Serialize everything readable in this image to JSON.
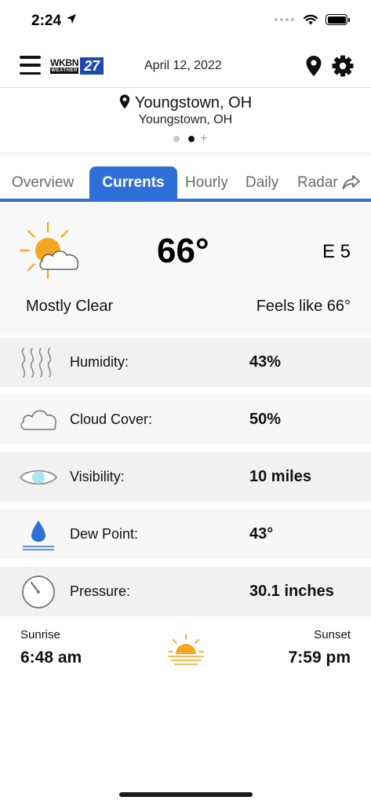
{
  "status_bar": {
    "time": "2:24"
  },
  "header": {
    "logo_brand": "WKBN",
    "logo_sub": "WEATHER",
    "logo_number": "27",
    "date": "April 12, 2022"
  },
  "location": {
    "name": "Youngstown, OH",
    "subtitle": "Youngstown, OH"
  },
  "tabs": [
    {
      "label": "Overview"
    },
    {
      "label": "Currents"
    },
    {
      "label": "Hourly"
    },
    {
      "label": "Daily"
    },
    {
      "label": "Radar"
    }
  ],
  "current": {
    "temperature": "66°",
    "wind": "E 5",
    "condition": "Mostly Clear",
    "feels_like": "Feels like 66°",
    "icon": "partly-cloudy-sun-icon"
  },
  "details": [
    {
      "label": "Humidity:",
      "value": "43%",
      "icon": "humidity-waves-icon"
    },
    {
      "label": "Cloud Cover:",
      "value": "50%",
      "icon": "cloud-icon"
    },
    {
      "label": "Visibility:",
      "value": "10 miles",
      "icon": "eye-icon"
    },
    {
      "label": "Dew Point:",
      "value": "43°",
      "icon": "droplet-icon"
    },
    {
      "label": "Pressure:",
      "value": "30.1 inches",
      "icon": "gauge-icon"
    }
  ],
  "sun": {
    "sunrise_label": "Sunrise",
    "sunrise_time": "6:48 am",
    "sunset_label": "Sunset",
    "sunset_time": "7:59 pm"
  },
  "colors": {
    "accent": "#2f6fd8",
    "sun": "#f5a623",
    "water": "#2f6fd8",
    "eye": "#a8e6f0"
  }
}
